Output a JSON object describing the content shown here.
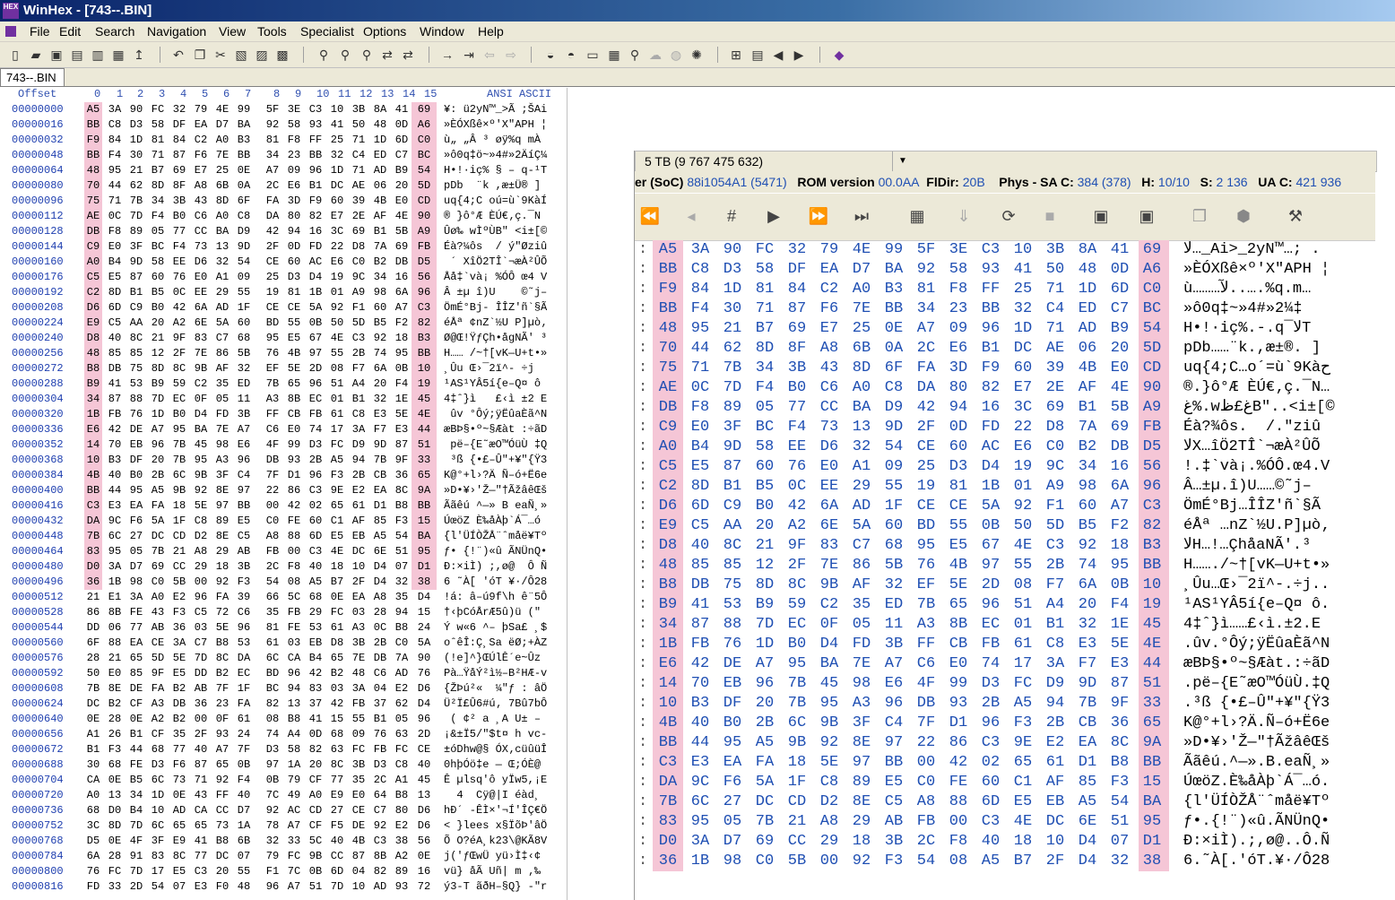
{
  "window": {
    "title": "WinHex - [743--.BIN]"
  },
  "menu": [
    "File",
    "Edit",
    "Search",
    "Navigation",
    "View",
    "Tools",
    "Specialist",
    "Options",
    "Window",
    "Help"
  ],
  "toolbar_icons": [
    "new-icon",
    "open-icon",
    "save-icon",
    "save-as-icon",
    "print-icon",
    "print-preview-icon",
    "properties-icon",
    "export-icon",
    "undo-icon",
    "copy-icon",
    "cut-icon",
    "paste-icon",
    "clipboard-icon",
    "write-icon",
    "find-icon",
    "find-next-icon",
    "find-hex-icon",
    "replace-icon",
    "replace-hex-icon",
    "goto-offset-icon",
    "goto-sector-icon",
    "back-icon",
    "forward-icon",
    "disk-icon",
    "disk-open-icon",
    "ram-icon",
    "calculator-icon",
    "zoom-icon",
    "cloud-icon",
    "info-icon",
    "tools-icon",
    "grid-icon",
    "table-icon",
    "prev-icon",
    "next-icon",
    "book-icon"
  ],
  "tab": {
    "label": "743--.BIN"
  },
  "header": {
    "offset": "Offset",
    "cols": [
      "0",
      "1",
      "2",
      "3",
      "4",
      "5",
      "6",
      "7",
      "8",
      "9",
      "10",
      "11",
      "12",
      "13",
      "14",
      "15"
    ],
    "ascii": "ANSI ASCII"
  },
  "rows": [
    {
      "offset": "00000000",
      "hex": [
        "A5",
        "3A",
        "90",
        "FC",
        "32",
        "79",
        "4E",
        "99",
        "5F",
        "3E",
        "C3",
        "10",
        "3B",
        "8A",
        "41",
        "69"
      ],
      "ascii": "¥: ü2yN™_>Ã ;ŠAi"
    },
    {
      "offset": "00000016",
      "hex": [
        "BB",
        "C8",
        "D3",
        "58",
        "DF",
        "EA",
        "D7",
        "BA",
        "92",
        "58",
        "93",
        "41",
        "50",
        "48",
        "0D",
        "A6"
      ],
      "ascii": "»ÈÓXßê×º'X\"APH ¦"
    },
    {
      "offset": "00000032",
      "hex": [
        "F9",
        "84",
        "1D",
        "81",
        "84",
        "C2",
        "A0",
        "B3",
        "81",
        "F8",
        "FF",
        "25",
        "71",
        "1D",
        "6D",
        "C0"
      ],
      "ascii": "ù„ „Â ³ øÿ%q mÀ"
    },
    {
      "offset": "00000048",
      "hex": [
        "BB",
        "F4",
        "30",
        "71",
        "87",
        "F6",
        "7E",
        "BB",
        "34",
        "23",
        "BB",
        "32",
        "C4",
        "ED",
        "C7",
        "BC"
      ],
      "ascii": "»ô0q‡ö~»4#»2ÄíÇ¼"
    },
    {
      "offset": "00000064",
      "hex": [
        "48",
        "95",
        "21",
        "B7",
        "69",
        "E7",
        "25",
        "0E",
        "A7",
        "09",
        "96",
        "1D",
        "71",
        "AD",
        "B9",
        "54"
      ],
      "ascii": "H•!·iç% § – q-¹T"
    },
    {
      "offset": "00000080",
      "hex": [
        "70",
        "44",
        "62",
        "8D",
        "8F",
        "A8",
        "6B",
        "0A",
        "2C",
        "E6",
        "B1",
        "DC",
        "AE",
        "06",
        "20",
        "5D"
      ],
      "ascii": "pDb  ¨k ,æ±Ü® ]"
    },
    {
      "offset": "00000096",
      "hex": [
        "75",
        "71",
        "7B",
        "34",
        "3B",
        "43",
        "8D",
        "6F",
        "FA",
        "3D",
        "F9",
        "60",
        "39",
        "4B",
        "E0",
        "CD"
      ],
      "ascii": "uq{4;C oú=ù`9KàÍ"
    },
    {
      "offset": "00000112",
      "hex": [
        "AE",
        "0C",
        "7D",
        "F4",
        "B0",
        "C6",
        "A0",
        "C8",
        "DA",
        "80",
        "82",
        "E7",
        "2E",
        "AF",
        "4E",
        "90"
      ],
      "ascii": "® }ô°Æ ÈÚ€‚ç.¯N "
    },
    {
      "offset": "00000128",
      "hex": [
        "DB",
        "F8",
        "89",
        "05",
        "77",
        "CC",
        "BA",
        "D9",
        "42",
        "94",
        "16",
        "3C",
        "69",
        "B1",
        "5B",
        "A9"
      ],
      "ascii": "Ûø‰ wÌºÙB\" <i±[©"
    },
    {
      "offset": "00000144",
      "hex": [
        "C9",
        "E0",
        "3F",
        "BC",
        "F4",
        "73",
        "13",
        "9D",
        "2F",
        "0D",
        "FD",
        "22",
        "D8",
        "7A",
        "69",
        "FB"
      ],
      "ascii": "Éà?¼ôs  / ý\"Øziû"
    },
    {
      "offset": "00000160",
      "hex": [
        "A0",
        "B4",
        "9D",
        "58",
        "EE",
        "D6",
        "32",
        "54",
        "CE",
        "60",
        "AC",
        "E6",
        "C0",
        "B2",
        "DB",
        "D5"
      ],
      "ascii": " ´ XîÖ2TÎ`¬æÀ²ÛÕ"
    },
    {
      "offset": "00000176",
      "hex": [
        "C5",
        "E5",
        "87",
        "60",
        "76",
        "E0",
        "A1",
        "09",
        "25",
        "D3",
        "D4",
        "19",
        "9C",
        "34",
        "16",
        "56"
      ],
      "ascii": "Åå‡`và¡ %ÓÔ œ4 V"
    },
    {
      "offset": "00000192",
      "hex": [
        "C2",
        "8D",
        "B1",
        "B5",
        "0C",
        "EE",
        "29",
        "55",
        "19",
        "81",
        "1B",
        "01",
        "A9",
        "98",
        "6A",
        "96"
      ],
      "ascii": "Â ±µ î)U    ©˜j–"
    },
    {
      "offset": "00000208",
      "hex": [
        "D6",
        "6D",
        "C9",
        "B0",
        "42",
        "6A",
        "AD",
        "1F",
        "CE",
        "CE",
        "5A",
        "92",
        "F1",
        "60",
        "A7",
        "C3"
      ],
      "ascii": "ÖmÉ°Bj- ÎÎZ'ñ`§Ã"
    },
    {
      "offset": "00000224",
      "hex": [
        "E9",
        "C5",
        "AA",
        "20",
        "A2",
        "6E",
        "5A",
        "60",
        "BD",
        "55",
        "0B",
        "50",
        "5D",
        "B5",
        "F2",
        "82"
      ],
      "ascii": "éÅª ¢nZ`½U P]µò‚"
    },
    {
      "offset": "00000240",
      "hex": [
        "D8",
        "40",
        "8C",
        "21",
        "9F",
        "83",
        "C7",
        "68",
        "95",
        "E5",
        "67",
        "4E",
        "C3",
        "92",
        "18",
        "B3"
      ],
      "ascii": "Ø@Œ!ŸƒÇh•ågNÃ' ³"
    },
    {
      "offset": "00000256",
      "hex": [
        "48",
        "85",
        "85",
        "12",
        "2F",
        "7E",
        "86",
        "5B",
        "76",
        "4B",
        "97",
        "55",
        "2B",
        "74",
        "95",
        "BB"
      ],
      "ascii": "H…… /~†[vK—U+t•»"
    },
    {
      "offset": "00000272",
      "hex": [
        "B8",
        "DB",
        "75",
        "8D",
        "8C",
        "9B",
        "AF",
        "32",
        "EF",
        "5E",
        "2D",
        "08",
        "F7",
        "6A",
        "0B",
        "10"
      ],
      "ascii": "¸Ûu Œ›¯2ï^- ÷j  "
    },
    {
      "offset": "00000288",
      "hex": [
        "B9",
        "41",
        "53",
        "B9",
        "59",
        "C2",
        "35",
        "ED",
        "7B",
        "65",
        "96",
        "51",
        "A4",
        "20",
        "F4",
        "19"
      ],
      "ascii": "¹AS¹YÂ5í{e–Q¤ ô "
    },
    {
      "offset": "00000304",
      "hex": [
        "34",
        "87",
        "88",
        "7D",
        "EC",
        "0F",
        "05",
        "11",
        "A3",
        "8B",
        "EC",
        "01",
        "B1",
        "32",
        "1E",
        "45"
      ],
      "ascii": "4‡ˆ}ì   £‹ì ±2 E"
    },
    {
      "offset": "00000320",
      "hex": [
        "1B",
        "FB",
        "76",
        "1D",
        "B0",
        "D4",
        "FD",
        "3B",
        "FF",
        "CB",
        "FB",
        "61",
        "C8",
        "E3",
        "5E",
        "4E"
      ],
      "ascii": " ûv °Ôý;ÿËûaÈã^N"
    },
    {
      "offset": "00000336",
      "hex": [
        "E6",
        "42",
        "DE",
        "A7",
        "95",
        "BA",
        "7E",
        "A7",
        "C6",
        "E0",
        "74",
        "17",
        "3A",
        "F7",
        "E3",
        "44"
      ],
      "ascii": "æBÞ§•º~§Æàt :÷ãD"
    },
    {
      "offset": "00000352",
      "hex": [
        "14",
        "70",
        "EB",
        "96",
        "7B",
        "45",
        "98",
        "E6",
        "4F",
        "99",
        "D3",
        "FC",
        "D9",
        "9D",
        "87",
        "51"
      ],
      "ascii": " pë–{E˜æO™ÓüÙ ‡Q"
    },
    {
      "offset": "00000368",
      "hex": [
        "10",
        "B3",
        "DF",
        "20",
        "7B",
        "95",
        "A3",
        "96",
        "DB",
        "93",
        "2B",
        "A5",
        "94",
        "7B",
        "9F",
        "33"
      ],
      "ascii": " ³ß {•£–Û\"+¥\"{Ÿ3"
    },
    {
      "offset": "00000384",
      "hex": [
        "4B",
        "40",
        "B0",
        "2B",
        "6C",
        "9B",
        "3F",
        "C4",
        "7F",
        "D1",
        "96",
        "F3",
        "2B",
        "CB",
        "36",
        "65"
      ],
      "ascii": "K@°+l›?Ä Ñ–ó+Ë6e"
    },
    {
      "offset": "00000400",
      "hex": [
        "BB",
        "44",
        "95",
        "A5",
        "9B",
        "92",
        "8E",
        "97",
        "22",
        "86",
        "C3",
        "9E",
        "E2",
        "EA",
        "8C",
        "9A"
      ],
      "ascii": "»D•¥›'Ž—\"†ÃžâêŒš"
    },
    {
      "offset": "00000416",
      "hex": [
        "C3",
        "E3",
        "EA",
        "FA",
        "18",
        "5E",
        "97",
        "BB",
        "00",
        "42",
        "02",
        "65",
        "61",
        "D1",
        "B8",
        "BB"
      ],
      "ascii": "Ããêú ^—» B eaÑ¸»"
    },
    {
      "offset": "00000432",
      "hex": [
        "DA",
        "9C",
        "F6",
        "5A",
        "1F",
        "C8",
        "89",
        "E5",
        "C0",
        "FE",
        "60",
        "C1",
        "AF",
        "85",
        "F3",
        "15"
      ],
      "ascii": "ÚœöZ È‰åÀþ`Á¯…ó "
    },
    {
      "offset": "00000448",
      "hex": [
        "7B",
        "6C",
        "27",
        "DC",
        "CD",
        "D2",
        "8E",
        "C5",
        "A8",
        "88",
        "6D",
        "E5",
        "EB",
        "A5",
        "54",
        "BA"
      ],
      "ascii": "{l'ÜÍÒŽÅ¨ˆmåë¥Tº"
    },
    {
      "offset": "00000464",
      "hex": [
        "83",
        "95",
        "05",
        "7B",
        "21",
        "A8",
        "29",
        "AB",
        "FB",
        "00",
        "C3",
        "4E",
        "DC",
        "6E",
        "51",
        "95"
      ],
      "ascii": "ƒ• {!¨)«û ÃNÜnQ•"
    },
    {
      "offset": "00000480",
      "hex": [
        "D0",
        "3A",
        "D7",
        "69",
        "CC",
        "29",
        "18",
        "3B",
        "2C",
        "F8",
        "40",
        "18",
        "10",
        "D4",
        "07",
        "D1"
      ],
      "ascii": "Ð:×iÌ) ;,ø@  Ô Ñ"
    },
    {
      "offset": "00000496",
      "hex": [
        "36",
        "1B",
        "98",
        "C0",
        "5B",
        "00",
        "92",
        "F3",
        "54",
        "08",
        "A5",
        "B7",
        "2F",
        "D4",
        "32",
        "38"
      ],
      "ascii": "6 ˜À[ 'óT ¥·/Ô28"
    },
    {
      "offset": "00000512",
      "hex": [
        "21",
        "E1",
        "3A",
        "A0",
        "E2",
        "96",
        "FA",
        "39",
        "66",
        "5C",
        "68",
        "0E",
        "EA",
        "A8",
        "35",
        "D4"
      ],
      "ascii": "!á: â–ú9f\\h ê¨5Ô"
    },
    {
      "offset": "00000528",
      "hex": [
        "86",
        "8B",
        "FE",
        "43",
        "F3",
        "C5",
        "72",
        "C6",
        "35",
        "FB",
        "29",
        "FC",
        "03",
        "28",
        "94",
        "15"
      ],
      "ascii": "†‹þCóÅrÆ5û)ü (\" "
    },
    {
      "offset": "00000544",
      "hex": [
        "DD",
        "06",
        "77",
        "AB",
        "36",
        "03",
        "5E",
        "96",
        "81",
        "FE",
        "53",
        "61",
        "A3",
        "0C",
        "B8",
        "24"
      ],
      "ascii": "Ý w«6 ^– þSa£ ¸$"
    },
    {
      "offset": "00000560",
      "hex": [
        "6F",
        "88",
        "EA",
        "CE",
        "3A",
        "C7",
        "B8",
        "53",
        "61",
        "03",
        "EB",
        "D8",
        "3B",
        "2B",
        "C0",
        "5A"
      ],
      "ascii": "oˆêÎ:Ç¸Sa ëØ;+ÀZ"
    },
    {
      "offset": "00000576",
      "hex": [
        "28",
        "21",
        "65",
        "5D",
        "5E",
        "7D",
        "8C",
        "DA",
        "6C",
        "CA",
        "B4",
        "65",
        "7E",
        "DB",
        "7A",
        "90"
      ],
      "ascii": "(!e]^}ŒÚlÊ´e~Ûz "
    },
    {
      "offset": "00000592",
      "hex": [
        "50",
        "E0",
        "85",
        "9F",
        "E5",
        "DD",
        "B2",
        "EC",
        "BD",
        "96",
        "42",
        "B2",
        "48",
        "C6",
        "AD",
        "76"
      ],
      "ascii": "Pà…ŸåÝ²ì½–B²HÆ-v"
    },
    {
      "offset": "00000608",
      "hex": [
        "7B",
        "8E",
        "DE",
        "FA",
        "B2",
        "AB",
        "7F",
        "1F",
        "BC",
        "94",
        "83",
        "03",
        "3A",
        "04",
        "E2",
        "D6"
      ],
      "ascii": "{ŽÞú²«  ¼\"ƒ : âÖ"
    },
    {
      "offset": "00000624",
      "hex": [
        "DC",
        "B2",
        "CF",
        "A3",
        "DB",
        "36",
        "23",
        "FA",
        "82",
        "13",
        "37",
        "42",
        "FB",
        "37",
        "62",
        "D4"
      ],
      "ascii": "Ü²Ï£Û6#ú‚ 7Bû7bÔ"
    },
    {
      "offset": "00000640",
      "hex": [
        "0E",
        "28",
        "0E",
        "A2",
        "B2",
        "00",
        "0F",
        "61",
        "08",
        "B8",
        "41",
        "15",
        "55",
        "B1",
        "05",
        "96"
      ],
      "ascii": " ( ¢² a ¸A U± –"
    },
    {
      "offset": "00000656",
      "hex": [
        "A1",
        "26",
        "B1",
        "CF",
        "35",
        "2F",
        "93",
        "24",
        "74",
        "A4",
        "0D",
        "68",
        "09",
        "76",
        "63",
        "2D"
      ],
      "ascii": "¡&±Ï5/\"$t¤ h vc-"
    },
    {
      "offset": "00000672",
      "hex": [
        "B1",
        "F3",
        "44",
        "68",
        "77",
        "40",
        "A7",
        "7F",
        "D3",
        "58",
        "82",
        "63",
        "FC",
        "FB",
        "FC",
        "CE"
      ],
      "ascii": "±óDhw@§ ÓX‚cüûüÎ"
    },
    {
      "offset": "00000688",
      "hex": [
        "30",
        "68",
        "FE",
        "D3",
        "F6",
        "87",
        "65",
        "0B",
        "97",
        "1A",
        "20",
        "8C",
        "3B",
        "D3",
        "C8",
        "40"
      ],
      "ascii": "0hþÓö‡e — Œ;ÓÈ@"
    },
    {
      "offset": "00000704",
      "hex": [
        "CA",
        "0E",
        "B5",
        "6C",
        "73",
        "71",
        "92",
        "F4",
        "0B",
        "79",
        "CF",
        "77",
        "35",
        "2C",
        "A1",
        "45"
      ],
      "ascii": "Ê µlsq'ô yÏw5,¡E"
    },
    {
      "offset": "00000720",
      "hex": [
        "A0",
        "13",
        "34",
        "1D",
        "0E",
        "43",
        "FF",
        "40",
        "7C",
        "49",
        "A0",
        "E9",
        "E0",
        "64",
        "B8",
        "13"
      ],
      "ascii": "  4  Cÿ@|I éàd¸ "
    },
    {
      "offset": "00000736",
      "hex": [
        "68",
        "D0",
        "B4",
        "10",
        "AD",
        "CA",
        "CC",
        "D7",
        "92",
        "AC",
        "CD",
        "27",
        "CE",
        "C7",
        "80",
        "D6"
      ],
      "ascii": "hÐ´ -ÊÌ×'¬Í'ÎÇ€Ö"
    },
    {
      "offset": "00000752",
      "hex": [
        "3C",
        "8D",
        "7D",
        "6C",
        "65",
        "65",
        "73",
        "1A",
        "78",
        "A7",
        "CF",
        "F5",
        "DE",
        "92",
        "E2",
        "D6"
      ],
      "ascii": "< }lees x§ÏõÞ'âÖ"
    },
    {
      "offset": "00000768",
      "hex": [
        "D5",
        "0E",
        "4F",
        "3F",
        "E9",
        "41",
        "B8",
        "6B",
        "32",
        "33",
        "5C",
        "40",
        "4B",
        "C3",
        "38",
        "56"
      ],
      "ascii": "Õ O?éA¸k23\\@KÃ8V"
    },
    {
      "offset": "00000784",
      "hex": [
        "6A",
        "28",
        "91",
        "83",
        "8C",
        "77",
        "DC",
        "07",
        "79",
        "FC",
        "9B",
        "CC",
        "87",
        "8B",
        "A2",
        "0E"
      ],
      "ascii": "j('ƒŒwÜ yü›Ì‡‹¢ "
    },
    {
      "offset": "00000800",
      "hex": [
        "76",
        "FC",
        "7D",
        "17",
        "E5",
        "C3",
        "20",
        "55",
        "F1",
        "7C",
        "0B",
        "6D",
        "04",
        "82",
        "89",
        "16"
      ],
      "ascii": "vü} åÃ Uñ| m ‚‰ "
    },
    {
      "offset": "00000816",
      "hex": [
        "FD",
        "33",
        "2D",
        "54",
        "07",
        "E3",
        "F0",
        "48",
        "96",
        "A7",
        "51",
        "7D",
        "10",
        "AD",
        "93",
        "72"
      ],
      "ascii": "ý3-T ãðH–§Q} -\"r"
    }
  ],
  "zoom": {
    "capacity": "5 TB (9 767 475 632)",
    "info": [
      {
        "k": "er (SoC)",
        "v": "88i1054A1 (5471)"
      },
      {
        "k": "ROM version",
        "v": "00.0AA"
      },
      {
        "k": "FlDir:",
        "v": "20B"
      },
      {
        "k": "Phys - SA C:",
        "v": "384 (378)"
      },
      {
        "k": "H:",
        "v": "10/10"
      },
      {
        "k": "S:",
        "v": "2 136"
      },
      {
        "k": "UA C:",
        "v": "421 936"
      }
    ],
    "tools": [
      "rewind-icon",
      "step-back-icon",
      "hash-icon",
      "play-icon",
      "fast-forward-icon",
      "skip-end-icon",
      "keyboard-icon",
      "download-icon",
      "refresh-icon",
      "stop-icon",
      "chip-icon",
      "chip-alt-icon",
      "copy-doc-icon",
      "stop-sign-icon",
      "hammer-icon"
    ],
    "ascii_rows": [
      "لا…_Ai>_2yN™…; .",
      "»ÈÓXßê×º'X\"APH ¦",
      "ù………لآ..….%q.m…",
      "»ô0q‡~»4#»2¼‡",
      "H•!·iç%.-.q¯لاT",
      "pDb……¨k.,æ±®. ]",
      "uq{4;C…o´=ù`9Kàح",
      "®.}ô°Æ ÈÚ€‚ç.¯N…",
      "غ%.wغ£ظB\"..<i±[©",
      "Éà?¾ôs.  /.\"ziû",
      "لاX…îÖ2TÎ`¬æÀ²ÛÕ",
      "!.‡`và¡.%ÓÔ.œ4.V",
      "Â…±µ.î)U……©˜j–",
      "ÖmÉ°Bj…ÎÎZ'ñ`§Ã",
      "éÅª …nZ`½U.P]µò‚",
      "لاH…!…ÇhåaNÃ'.³",
      "H……./~†[vK—U+t•»",
      "¸Ûu…Œ›¯2ï^-.÷j..",
      "¹AS¹YÂ5í{e–Q¤ ô.",
      "4‡ˆ}ì……£‹ì.±2.E",
      ".ûv.°Ôý;ÿËûaÈã^N",
      "æBÞ§•º~§Æàt.:÷ãD",
      ".pë–{E˜æO™ÓüÙ.‡Q",
      ".³ß {•£–Û\"+¥\"{Ÿ3",
      "K@°+l›?Ä.Ñ–ó+Ë6e",
      "»D•¥›'Ž—\"†ÃžâêŒš",
      "Ããêú.^—».B.eaÑ¸»",
      "ÚœöZ.È‰åÀþ`Á¯…ó.",
      "{l'ÜÍÒŽÅ¨ˆmåë¥Tº",
      "ƒ•.{!¨)«û.ÃNÜnQ•",
      "Ð:×iÌ).;,ø@..Ô.Ñ",
      "6.˜À[.'óT.¥·/Ô28"
    ]
  }
}
